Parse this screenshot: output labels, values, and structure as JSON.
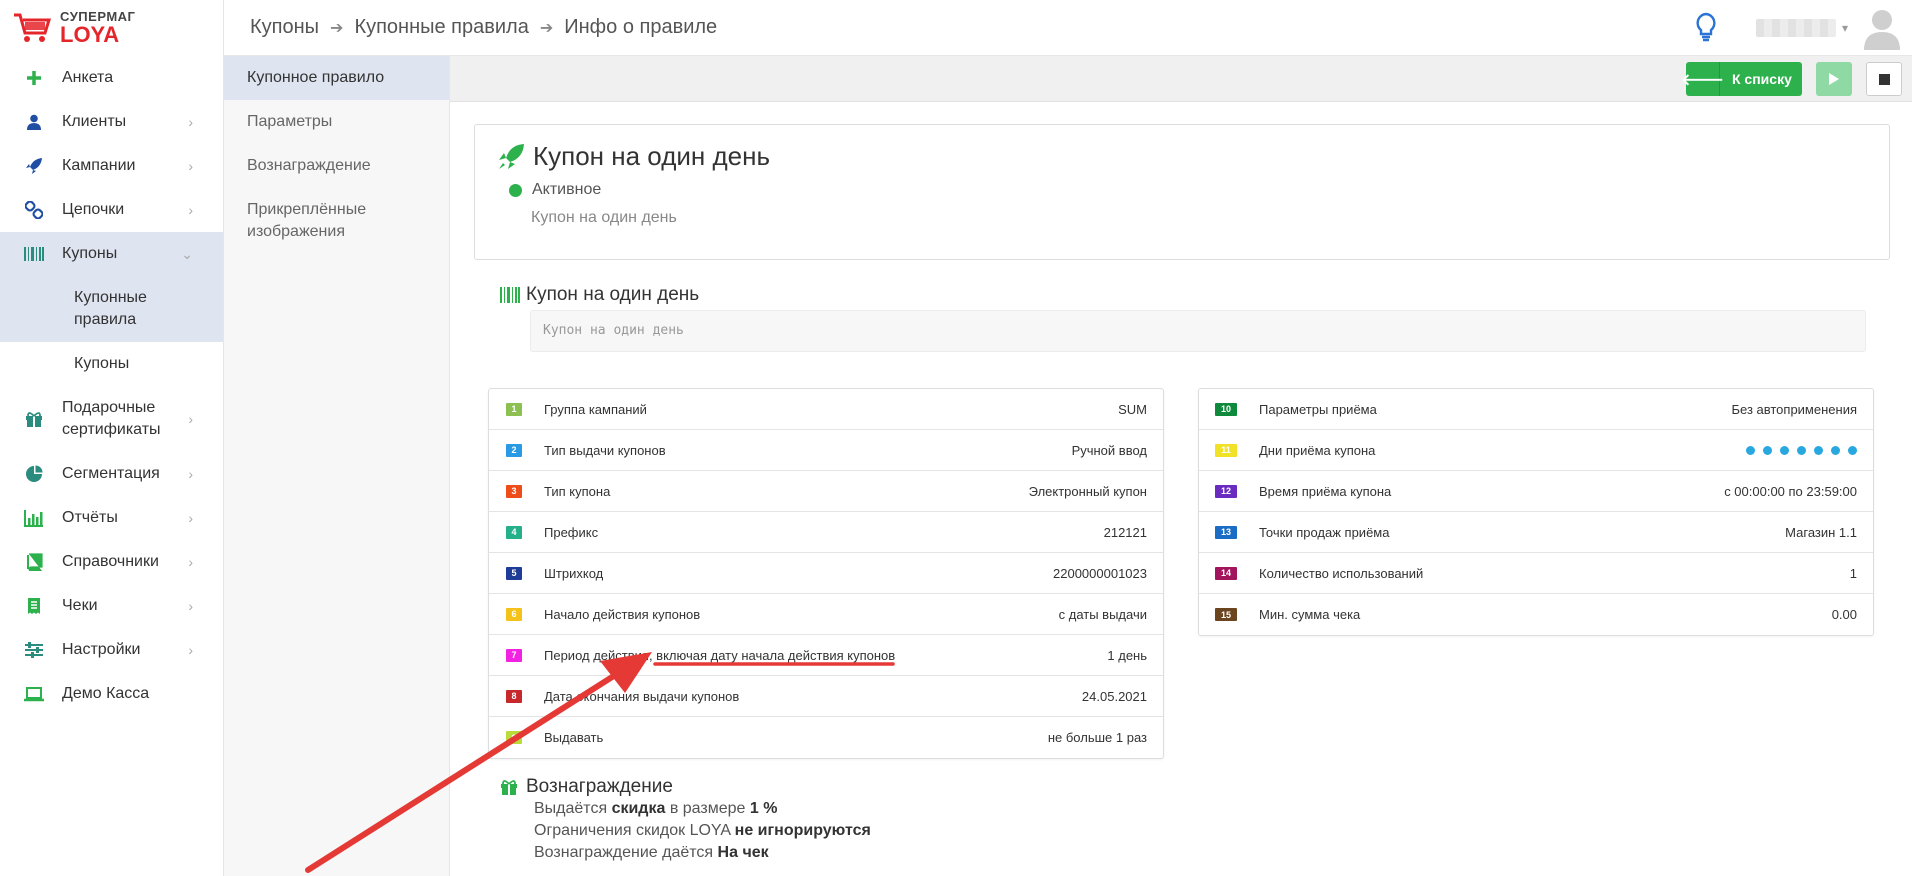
{
  "brand": {
    "line1": "СУПЕРМАГ",
    "line2": "LOYA"
  },
  "breadcrumb": [
    "Купоны",
    "Купонные правила",
    "Инфо о правиле"
  ],
  "sidebar": {
    "items": [
      {
        "label": "Анкета",
        "icon": "plus-icon"
      },
      {
        "label": "Клиенты",
        "icon": "user-icon"
      },
      {
        "label": "Кампании",
        "icon": "rocket-icon"
      },
      {
        "label": "Цепочки",
        "icon": "chain-icon"
      },
      {
        "label": "Купоны",
        "icon": "barcode-icon"
      },
      {
        "label": "Подарочные сертификаты",
        "icon": "gift-icon"
      },
      {
        "label": "Сегментация",
        "icon": "pie-icon"
      },
      {
        "label": "Отчёты",
        "icon": "bar-chart-icon"
      },
      {
        "label": "Справочники",
        "icon": "book-icon"
      },
      {
        "label": "Чеки",
        "icon": "receipt-icon"
      },
      {
        "label": "Настройки",
        "icon": "sliders-icon"
      },
      {
        "label": "Демо Касса",
        "icon": "laptop-icon"
      }
    ],
    "sub_items": [
      "Купонные правила",
      "Купоны"
    ]
  },
  "subnav": [
    "Купонное правило",
    "Параметры",
    "Вознаграждение",
    "Прикреплённые изображения"
  ],
  "toolbar": {
    "back_label": "К списку"
  },
  "rule": {
    "title": "Купон на один день",
    "status": "Активное",
    "description": "Купон на один день"
  },
  "coupon": {
    "title": "Купон на один день",
    "text": "Купон на один день"
  },
  "params_left": [
    {
      "n": "1",
      "color": "#8cc152",
      "name": "Группа кампаний",
      "value": "SUM"
    },
    {
      "n": "2",
      "color": "#2b9ae4",
      "name": "Тип выдачи купонов",
      "value": "Ручной ввод"
    },
    {
      "n": "3",
      "color": "#ee4d1a",
      "name": "Тип купона",
      "value": "Электронный купон"
    },
    {
      "n": "4",
      "color": "#23b08a",
      "name": "Префикс",
      "value": "212121"
    },
    {
      "n": "5",
      "color": "#1f3d97",
      "name": "Штрихкод",
      "value": "2200000001023"
    },
    {
      "n": "6",
      "color": "#f5c21a",
      "name": "Начало действия купонов",
      "value": "с даты выдачи"
    },
    {
      "n": "7",
      "color": "#f222e3",
      "name": "Период действия, включая дату начала действия купонов",
      "value": "1 день"
    },
    {
      "n": "8",
      "color": "#c6282b",
      "name": "Дата окончания выдачи купонов",
      "value": "24.05.2021"
    },
    {
      "n": "9",
      "color": "#b9dc3a",
      "name": "Выдавать",
      "value": "не больше 1 раз"
    }
  ],
  "params_right": [
    {
      "n": "10",
      "color": "#0f8a3c",
      "name": "Параметры приёма",
      "value": "Без автоприменения"
    },
    {
      "n": "11",
      "color": "#f2e227",
      "name": "Дни приёма купона",
      "value": ""
    },
    {
      "n": "12",
      "color": "#6a2bc1",
      "name": "Время приёма купона",
      "value": "с 00:00:00 по 23:59:00"
    },
    {
      "n": "13",
      "color": "#1a6cc4",
      "name": "Точки продаж приёма",
      "value": "Магазин 1.1"
    },
    {
      "n": "14",
      "color": "#a3145e",
      "name": "Количество использований",
      "value": "1"
    },
    {
      "n": "15",
      "color": "#6b4420",
      "name": "Мин. сумма чека",
      "value": "0.00"
    }
  ],
  "reward": {
    "title": "Вознаграждение",
    "line1_pre": "Выдаётся ",
    "line1_b1": "скидка",
    "line1_mid": " в размере ",
    "line1_b2": "1 %",
    "line2_pre": "Ограничения скидок LOYA ",
    "line2_b": "не игнорируются",
    "line3_pre": "Вознаграждение даётся ",
    "line3_b": "На чек"
  },
  "colors": {
    "green": "#2db14c",
    "annotation_red": "#e53935"
  }
}
